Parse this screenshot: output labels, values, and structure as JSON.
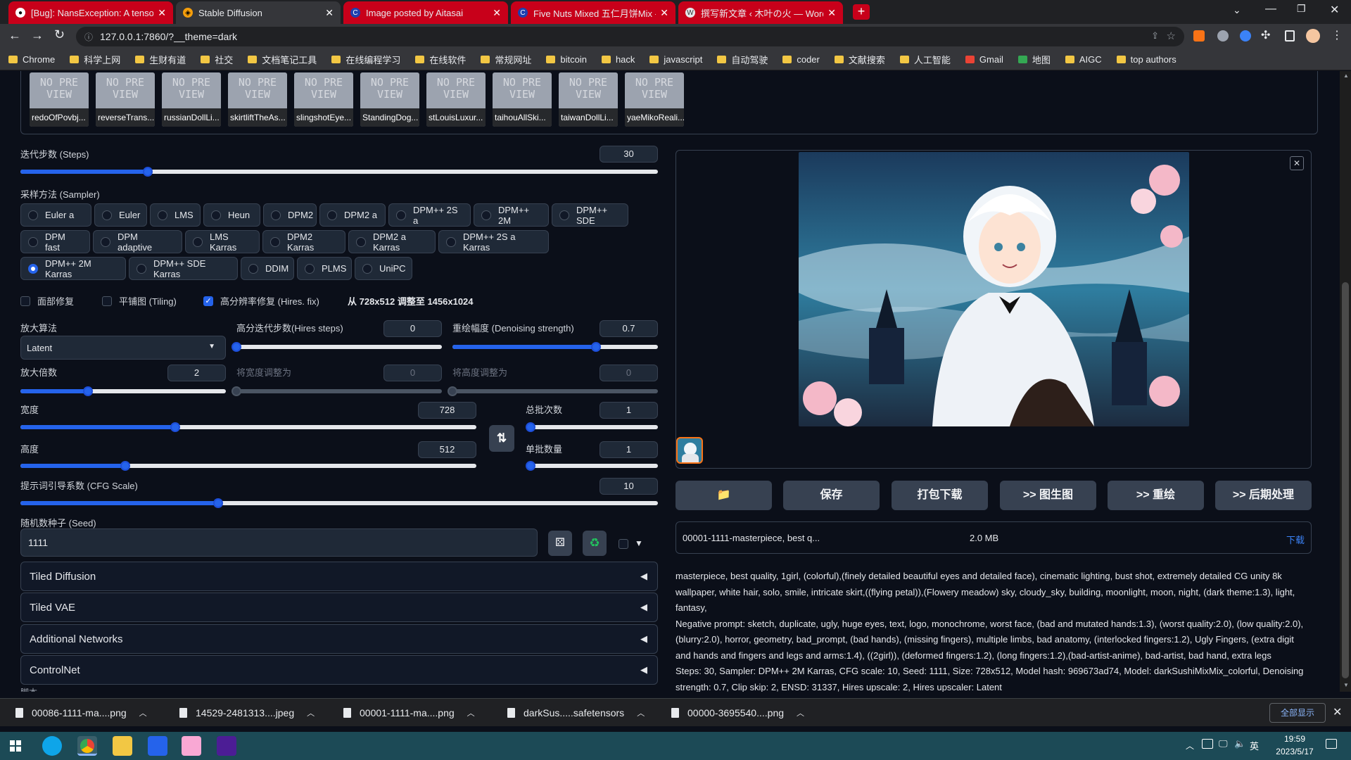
{
  "browser": {
    "tabs": [
      {
        "title": "[Bug]: NansException: A tenso",
        "active": false
      },
      {
        "title": "Stable Diffusion",
        "active": true
      },
      {
        "title": "Image posted by Aitasai",
        "active": false
      },
      {
        "title": "Five Nuts Mixed 五仁月饼Mix -",
        "active": false
      },
      {
        "title": "撰写新文章 ‹ 木叶の火 — Word",
        "active": false
      }
    ],
    "url": "127.0.0.1:7860/?__theme=dark",
    "bookmarks": [
      "Chrome",
      "科学上网",
      "生财有道",
      "社交",
      "文档笔记工具",
      "在线编程学习",
      "在线软件",
      "常规网址",
      "bitcoin",
      "hack",
      "javascript",
      "自动驾驶",
      "coder",
      "文献搜索",
      "人工智能",
      "Gmail",
      "地图",
      "AIGC",
      "top authors"
    ]
  },
  "lora_cards": [
    "redoOfPovbj...",
    "reverseTrans...",
    "russianDollLi...",
    "skirtliftTheAs...",
    "slingshotEye...",
    "StandingDog...",
    "stLouisLuxur...",
    "taihouAllSki...",
    "taiwanDollLi...",
    "yaeMikoReali..."
  ],
  "no_preview": "NO PREVIEW",
  "steps": {
    "label": "迭代步数 (Steps)",
    "value": "30",
    "fraction": 0.2
  },
  "sampler": {
    "label": "采样方法 (Sampler)",
    "options": [
      "Euler a",
      "Euler",
      "LMS",
      "Heun",
      "DPM2",
      "DPM2 a",
      "DPM++ 2S a",
      "DPM++ 2M",
      "DPM++ SDE",
      "DPM fast",
      "DPM adaptive",
      "LMS Karras",
      "DPM2 Karras",
      "DPM2 a Karras",
      "DPM++ 2S a Karras",
      "DPM++ 2M Karras",
      "DPM++ SDE Karras",
      "DDIM",
      "PLMS",
      "UniPC"
    ],
    "selected": "DPM++ 2M Karras"
  },
  "checks": {
    "face": {
      "label": "面部修复",
      "checked": false
    },
    "tiling": {
      "label": "平铺图 (Tiling)",
      "checked": false
    },
    "hires": {
      "label": "高分辨率修复 (Hires. fix)",
      "checked": true
    },
    "resize_note": "从 728x512 调整至 1456x1024"
  },
  "hires": {
    "upscaler_label": "放大算法",
    "upscaler_value": "Latent",
    "steps_label": "高分迭代步数(Hires steps)",
    "steps_value": "0",
    "steps_fraction": 0,
    "denoise_label": "重绘幅度 (Denoising strength)",
    "denoise_value": "0.7",
    "denoise_fraction": 0.7,
    "scale_label": "放大倍数",
    "scale_value": "2",
    "scale_fraction": 0.33,
    "resize_w_label": "将宽度调整为",
    "resize_w_value": "0",
    "resize_h_label": "将高度调整为",
    "resize_h_value": "0"
  },
  "size": {
    "width_label": "宽度",
    "width_value": "728",
    "width_fraction": 0.34,
    "height_label": "高度",
    "height_value": "512",
    "height_fraction": 0.23,
    "swap_icon": "swap-arrows-icon"
  },
  "batch": {
    "count_label": "总批次数",
    "count_value": "1",
    "size_label": "单批数量",
    "size_value": "1"
  },
  "cfg": {
    "label": "提示词引导系数 (CFG Scale)",
    "value": "10",
    "fraction": 0.31
  },
  "seed": {
    "label": "随机数种子 (Seed)",
    "value": "1111"
  },
  "accordions": [
    "Tiled Diffusion",
    "Tiled VAE",
    "Additional Networks",
    "ControlNet"
  ],
  "cutoff_text": "脚本",
  "output": {
    "buttons": [
      "📁",
      "保存",
      "打包下载",
      ">> 图生图",
      ">> 重绘",
      ">> 后期处理"
    ],
    "file_name": "00001-1111-masterpiece, best q...",
    "file_size": "2.0 MB",
    "download": "下载",
    "prompt": "masterpiece, best quality, 1girl, (colorful),(finely detailed beautiful eyes and detailed face), cinematic lighting, bust shot, extremely detailed CG unity 8k wallpaper, white hair, solo, smile, intricate skirt,((flying petal)),(Flowery meadow) sky, cloudy_sky, building, moonlight, moon, night, (dark theme:1.3), light, fantasy,",
    "negative": "Negative prompt: sketch, duplicate, ugly, huge eyes, text, logo, monochrome, worst face, (bad and mutated hands:1.3), (worst quality:2.0), (low quality:2.0), (blurry:2.0), horror, geometry, bad_prompt, (bad hands), (missing fingers), multiple limbs, bad anatomy, (interlocked fingers:1.2), Ugly Fingers, (extra digit and hands and fingers and legs and arms:1.4), ((2girl)), (deformed fingers:1.2), (long fingers:1.2),(bad-artist-anime), bad-artist, bad hand, extra legs",
    "params": "Steps: 30, Sampler: DPM++ 2M Karras, CFG scale: 10, Seed: 1111, Size: 728x512, Model hash: 969673ad74, Model: darkSushiMixMix_colorful, Denoising strength: 0.7, Clip skip: 2, ENSD: 31337, Hires upscale: 2, Hires upscaler: Latent"
  },
  "downloads": [
    "00086-1111-ma....png",
    "14529-2481313....jpeg",
    "00001-1111-ma....png",
    "darkSus.....safetensors",
    "00000-3695540....png"
  ],
  "show_all": "全部显示",
  "taskbar": {
    "time": "19:59",
    "date": "2023/5/17",
    "ime": "英"
  }
}
